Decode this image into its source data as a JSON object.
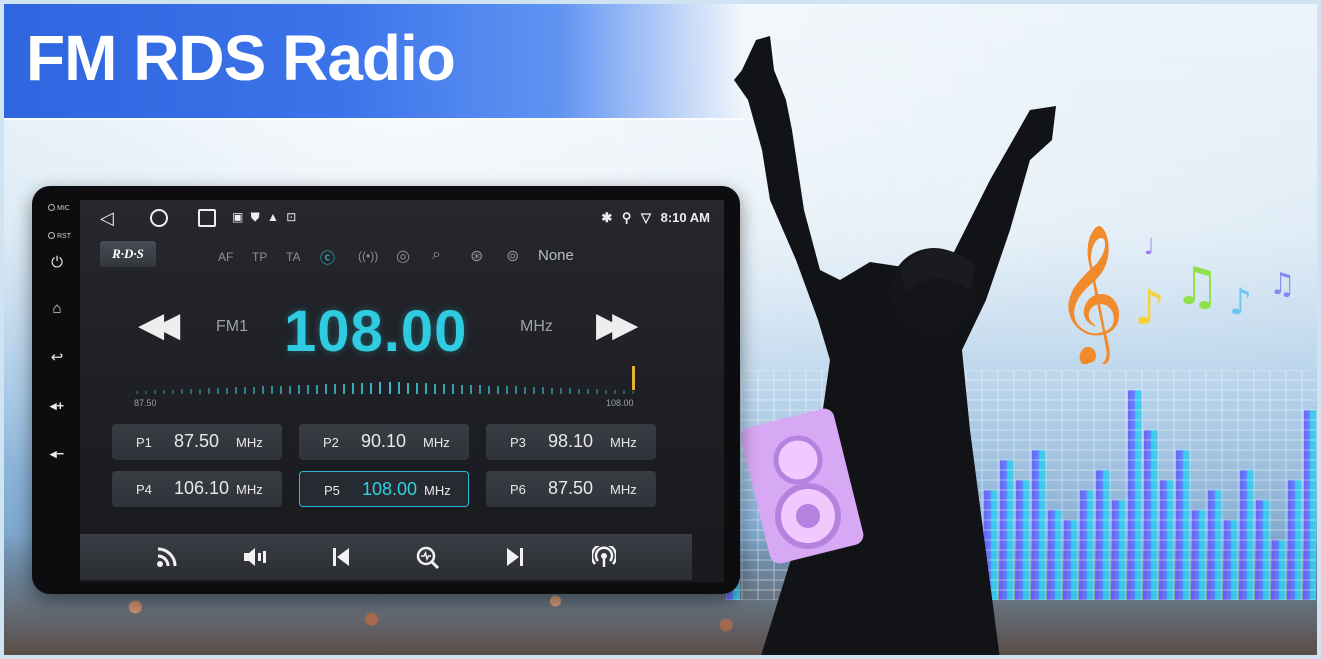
{
  "banner": {
    "title": "FM RDS Radio"
  },
  "side_keys": {
    "mic_label": "MIC",
    "rst_label": "RST",
    "power_icon": "power-icon",
    "home_icon": "home-icon",
    "back_icon": "back-icon",
    "vol_up_icon": "volume-up-icon",
    "vol_down_icon": "volume-down-icon"
  },
  "status_bar": {
    "time": "8:10 AM",
    "left_icons": "▣ ⛊ ▲ ⊡",
    "bluetooth": "✱",
    "location": "⚲",
    "wifi": "▽"
  },
  "rds": {
    "badge": "R·D·S",
    "options": [
      {
        "label": "AF",
        "active": false
      },
      {
        "label": "TP",
        "active": false
      },
      {
        "label": "TA",
        "active": false
      },
      {
        "label": "ⓒ",
        "active": true
      },
      {
        "label": "((•))",
        "active": false
      },
      {
        "label": "◎",
        "active": false
      },
      {
        "label": "⌕",
        "active": false
      },
      {
        "label": "⊛",
        "active": false
      },
      {
        "label": "⊚",
        "active": false
      }
    ],
    "pty": "None"
  },
  "tuner": {
    "band": "FM1",
    "frequency": "108.00",
    "unit": "MHz",
    "scale_min": "87.50",
    "scale_max": "108.00",
    "needle_position": 1.0
  },
  "presets": [
    {
      "id": "P1",
      "freq": "87.50",
      "unit": "MHz",
      "active": false
    },
    {
      "id": "P2",
      "freq": "90.10",
      "unit": "MHz",
      "active": false
    },
    {
      "id": "P3",
      "freq": "98.10",
      "unit": "MHz",
      "active": false
    },
    {
      "id": "P4",
      "freq": "106.10",
      "unit": "MHz",
      "active": false
    },
    {
      "id": "P5",
      "freq": "108.00",
      "unit": "MHz",
      "active": true
    },
    {
      "id": "P6",
      "freq": "87.50",
      "unit": "MHz",
      "active": false
    }
  ],
  "bottom_bar": {
    "buttons": [
      "rss-icon",
      "speaker-mode-icon",
      "skip-previous-icon",
      "scan-icon",
      "skip-next-icon",
      "broadcast-icon"
    ]
  },
  "colors": {
    "accent": "#2fcbe0",
    "needle": "#e7b233",
    "banner": "#2f66e0"
  }
}
